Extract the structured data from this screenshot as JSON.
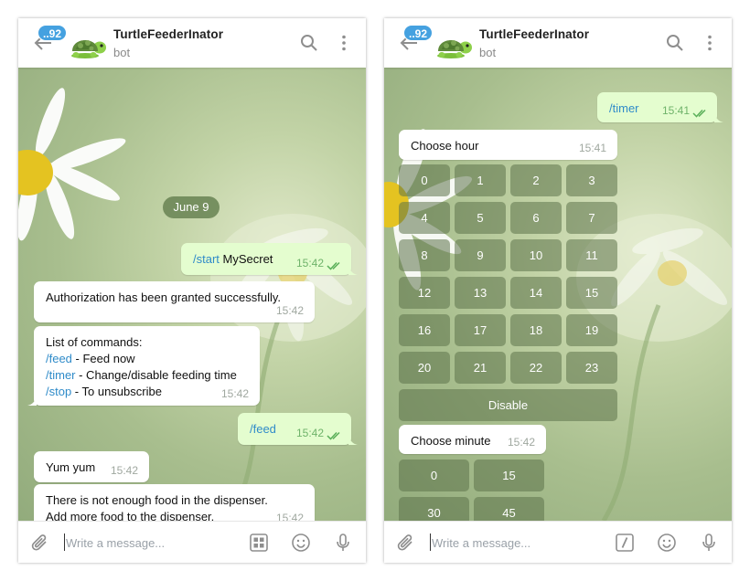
{
  "header": {
    "badge": "..92",
    "title": "TurtleFeederInator",
    "subtitle": "bot"
  },
  "composer": {
    "placeholder": "Write a message..."
  },
  "left": {
    "date": "June 9",
    "messages": [
      {
        "cmd": "/start",
        "text": " MySecret",
        "time": "15:42"
      },
      {
        "text": "Authorization has been granted successfully.",
        "time": "15:42"
      },
      {
        "title": "List of commands:",
        "lines": [
          {
            "cmd": "/feed",
            "text": " - Feed now"
          },
          {
            "cmd": "/timer",
            "text": " - Change/disable feeding time"
          },
          {
            "cmd": "/stop",
            "text": " - To unsubscribe"
          }
        ],
        "time": "15:42"
      },
      {
        "cmd": "/feed",
        "time": "15:42"
      },
      {
        "text": "Yum yum",
        "time": "15:42"
      },
      {
        "line1": "There is not enough food in the dispenser.",
        "line2": "Add more food to the dispenser.",
        "time": "15:42"
      }
    ]
  },
  "right": {
    "messages": [
      {
        "cmd": "/timer",
        "time": "15:41"
      },
      {
        "text": "Choose hour",
        "time": "15:41"
      },
      {
        "text": "Choose minute",
        "time": "15:42"
      }
    ],
    "hours": [
      "0",
      "1",
      "2",
      "3",
      "4",
      "5",
      "6",
      "7",
      "8",
      "9",
      "10",
      "11",
      "12",
      "13",
      "14",
      "15",
      "16",
      "17",
      "18",
      "19",
      "20",
      "21",
      "22",
      "23"
    ],
    "disable": "Disable",
    "minutes": [
      "0",
      "15",
      "30",
      "45"
    ]
  },
  "colors": {
    "accent": "#45a1e0",
    "outgoing": "#e4fdcf",
    "command": "#2f8bc9",
    "keyboard": "#5c724a"
  }
}
